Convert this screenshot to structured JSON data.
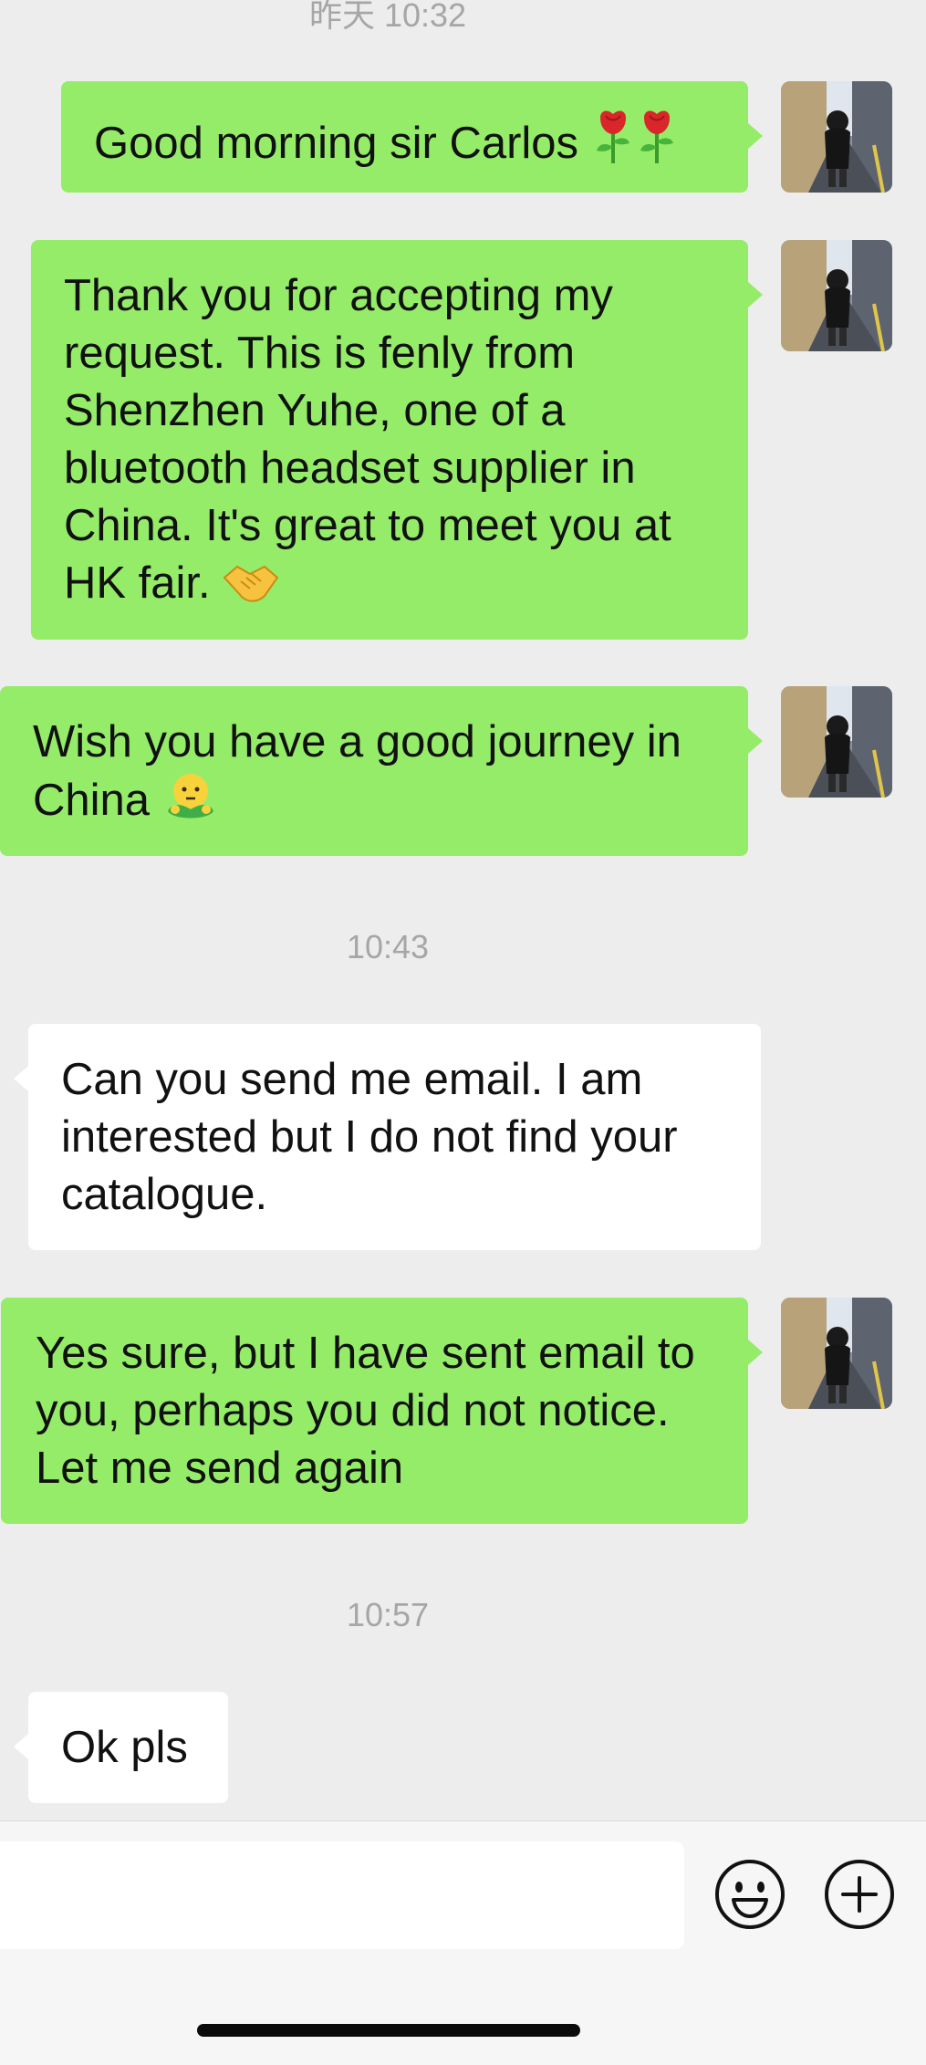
{
  "chat": {
    "timestamp_top": "昨天 10:32",
    "timestamp_2": "10:43",
    "timestamp_3": "10:57",
    "messages": [
      {
        "sender": "me",
        "text": "Good morning sir Carlos",
        "emoji": "rose-icon rose-icon"
      },
      {
        "sender": "me",
        "text": "Thank you for accepting my request. This is fenly from Shenzhen Yuhe, one of a bluetooth headset supplier in China. It's great to meet you at HK fair.",
        "emoji": "handshake-icon"
      },
      {
        "sender": "me",
        "text": "Wish you have a good journey in China",
        "emoji": "hug-face-icon"
      },
      {
        "sender": "other",
        "text": "Can you send me email. I am interested but I do not find your catalogue."
      },
      {
        "sender": "me",
        "text": "Yes sure, but I have sent email to you, perhaps you did not notice. Let me send again"
      },
      {
        "sender": "other",
        "text": "Ok pls"
      }
    ]
  },
  "input_bar": {
    "placeholder": "",
    "emoji_button_icon": "smiley-icon",
    "more_button_icon": "plus-circle-icon"
  },
  "colors": {
    "outgoing_bubble": "#95ec69",
    "incoming_bubble": "#ffffff",
    "background": "#ededed",
    "timestamp": "#a6a6a6"
  }
}
